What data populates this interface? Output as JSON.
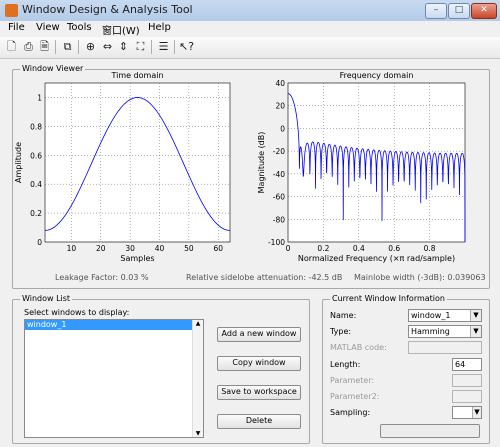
{
  "window": {
    "title": "Window Design & Analysis Tool",
    "minimize": "–",
    "maximize": "□",
    "close": "✕"
  },
  "menu": [
    "File",
    "View",
    "Tools",
    "窗口(W)",
    "Help"
  ],
  "viewer": {
    "title": "Window Viewer",
    "leakage": "Leakage Factor: 0.03 %",
    "sidelobe": "Relative sidelobe attenuation: -42.5 dB",
    "mainlobe": "Mainlobe width (-3dB): 0.039063"
  },
  "chart_data": [
    {
      "type": "line",
      "title": "Time domain",
      "xlabel": "Samples",
      "ylabel": "Amplitude",
      "xlim": [
        1,
        64
      ],
      "ylim": [
        0,
        1.1
      ],
      "xticks": [
        10,
        20,
        30,
        40,
        50,
        60
      ],
      "yticks": [
        0,
        0.2,
        0.4,
        0.6,
        0.8,
        1
      ],
      "ytick_labels": [
        "0",
        "0.2",
        "0.4",
        "0.6",
        "0.8",
        "1"
      ],
      "series": [
        {
          "color": "#0000ff",
          "function": "hamming",
          "N": 64
        }
      ],
      "grid": true
    },
    {
      "type": "line",
      "title": "Frequency domain",
      "xlabel": "Normalized Frequency (×π rad/sample)",
      "ylabel": "Magnitude (dB)",
      "xlim": [
        0,
        1
      ],
      "ylim": [
        -100,
        40
      ],
      "xticks": [
        0,
        0.2,
        0.4,
        0.6,
        0.8
      ],
      "xtick_labels": [
        "0",
        "0.2",
        "0.4",
        "0.6",
        "0.8"
      ],
      "yticks": [
        -100,
        -80,
        -60,
        -40,
        -20,
        0,
        20,
        40
      ],
      "series": [
        {
          "color": "#0000ff",
          "function": "hamming_spectrum_db",
          "N": 64
        }
      ],
      "grid": true
    }
  ],
  "window_list": {
    "title": "Window List",
    "prompt": "Select windows to display:",
    "items": [
      "window_1"
    ],
    "buttons": {
      "add": "Add a new window",
      "copy": "Copy window",
      "save": "Save to workspace",
      "delete": "Delete"
    }
  },
  "current": {
    "title": "Current Window Information",
    "name_label": "Name:",
    "name_value": "window_1",
    "type_label": "Type:",
    "type_value": "Hamming",
    "matlab_label": "MATLAB code:",
    "length_label": "Length:",
    "length_value": "64",
    "param_label": "Parameter:",
    "param2_label": "Parameter2:",
    "sampling_label": "Sampling:"
  }
}
